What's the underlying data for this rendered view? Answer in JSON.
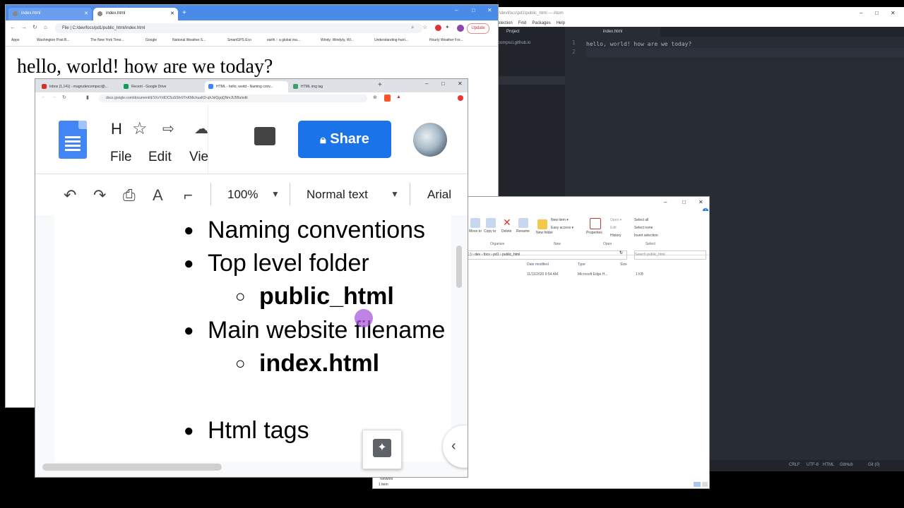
{
  "atom": {
    "title": "\\dev\\focs\\pd1\\public_html — Atom",
    "menu": [
      "election",
      "Find",
      "Packages",
      "Help"
    ],
    "tree": {
      "header": "Project",
      "item": "compsci.github.io"
    },
    "tab": "index.html",
    "lines": [
      "1",
      "2"
    ],
    "code": "hello, world! how are we today?",
    "status": {
      "crlf": "CRLF",
      "enc": "UTF-8",
      "grammar": "HTML",
      "github": "GitHub",
      "git": "Git (0)"
    }
  },
  "browser": {
    "tabs": [
      "index.html",
      "index.html"
    ],
    "update": "Update",
    "address": "File  |  C:/dev/focs/pd1/public_html/index.html",
    "bookmarks": [
      "Apps",
      "Washington Post B...",
      "The New York Time...",
      "Google",
      "National Weather S...",
      "SmartGPS Eco",
      "earth :: a global ma...",
      "Windy: Windyty, Wi...",
      "Understanding hurri...",
      "Hourly Weather For..."
    ],
    "page_text": "hello, world! how are we today?"
  },
  "explorer": {
    "ribbon": [
      "Move to",
      "Copy to",
      "Delete",
      "Rename",
      "New folder",
      "New item ▾",
      "Easy access ▾",
      "Properties",
      "Open ▾",
      "Edit",
      "History",
      "Select all",
      "Select none",
      "Invert selection"
    ],
    "groups": [
      "Organize",
      "New",
      "Open",
      "Select"
    ],
    "path": "C:) › dev › focs › pd1 › public_html",
    "search": "Search public_html",
    "cols": [
      "Date modified",
      "Type",
      "Size"
    ],
    "file": {
      "date": "11/11/2020 9:54 AM",
      "type": "Microsoft Edge H...",
      "size": "1 KB"
    },
    "nav_item": "Network",
    "status": "1 item"
  },
  "docs": {
    "tabs": [
      "Inbox (1,141) - magrudercompsci@...",
      "Recent - Google Drive",
      "HTML - hello, world - Naming conv...",
      "HTML img tag"
    ],
    "url": "docs.google.com/document/d/1XvYrtIDC5uSShr9TnKMichuaKD-qhJslQgqQNmJU5Bs/edit",
    "title_partial": "H",
    "menu": [
      "File",
      "Edit",
      "Vie"
    ],
    "share": "Share",
    "zoom": "100%",
    "style": "Normal text",
    "font": "Arial",
    "bullets": [
      {
        "text": "Naming conventions",
        "level": 1,
        "bold": false
      },
      {
        "text": "Top level folder",
        "level": 1,
        "bold": false
      },
      {
        "text": "public_html",
        "level": 2,
        "bold": true
      },
      {
        "text": "Main website filename",
        "level": 1,
        "bold": false
      },
      {
        "text": "index.html",
        "level": 2,
        "bold": true
      },
      {
        "text": "Html tags",
        "level": 1,
        "bold": false
      }
    ]
  }
}
